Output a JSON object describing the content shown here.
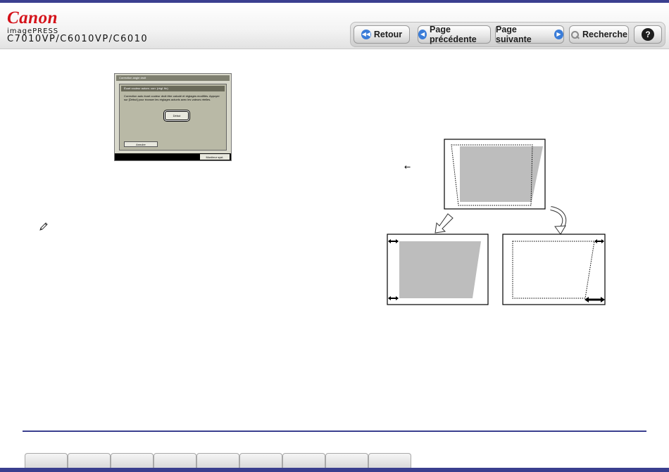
{
  "header": {
    "brand": "Canon",
    "product": "imagePRESS",
    "model": "C7010VP/C6010VP/C6010"
  },
  "nav": {
    "back": "Retour",
    "previous": "Page précédente",
    "next": "Page suivante",
    "search": "Recherche",
    "help": "?"
  },
  "lcd": {
    "window_title": "Correction angle droit",
    "panel_title": "Écart couleur autom. corr. (régl. fin)",
    "message": "Correction auto écart couleur droit être calculé et réglages modifiés. Appuyer sur [Début] pour écraser les réglages actuels avec les valeurs réelles.",
    "start": "Début",
    "cancel": "Annuler",
    "monitor": "Moniteur syst."
  },
  "annotation": {
    "arrow": "←"
  },
  "footer": {
    "tabs": [
      "",
      "",
      "",
      "",
      "",
      "",
      "",
      "",
      ""
    ]
  },
  "colors": {
    "brand": "#d4121a",
    "accent": "#3a3f8f",
    "button_icon": "#3a7cd8"
  }
}
